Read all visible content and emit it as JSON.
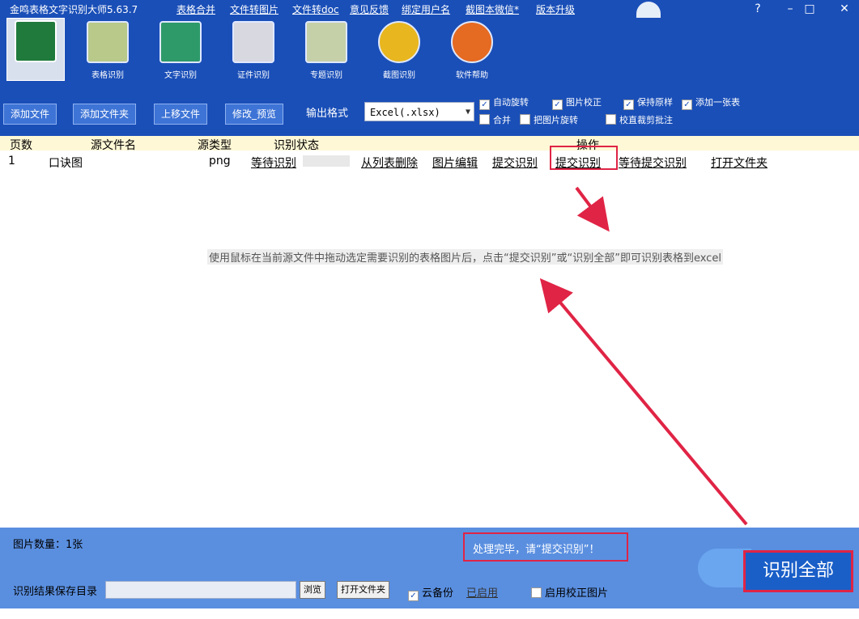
{
  "title_bar": {
    "app_title": "金鸣表格文字识别大师5.63.7",
    "menu": [
      "表格合并",
      "文件转图片",
      "文件转doc",
      "意见反馈",
      "绑定用户名",
      "截图本微信*",
      "版本升级"
    ],
    "win_min": "–",
    "win_max": "□",
    "win_close": "✕"
  },
  "toolbar": {
    "tools": [
      "",
      "表格识别",
      "文字识别",
      "证件识别",
      "专题识别",
      "截图识别",
      "软件帮助"
    ]
  },
  "options": {
    "buttons": [
      "添加文件",
      "添加文件夹",
      "上移文件",
      "修改_预览"
    ],
    "format_label": "输出格式",
    "format_value": "Excel(.xlsx)",
    "checkboxes_row1": [
      "自动旋转",
      "图片校正",
      "保持原样",
      "添加一张表"
    ],
    "checkboxes_row2": [
      "合并",
      "把图片旋转",
      "校直裁剪批注"
    ]
  },
  "table": {
    "headers": [
      "页数",
      "源文件名",
      "源类型",
      "识别状态",
      "操作"
    ],
    "row": {
      "page": "1",
      "filename": "口诀图",
      "type": "png",
      "status": "等待识别",
      "actions": [
        "从列表删除",
        "图片编辑",
        "提交识别",
        "提交识别",
        "等待提交识别",
        "打开文件夹"
      ]
    }
  },
  "hint": "使用鼠标在当前源文件中拖动选定需要识别的表格图片后，点击“提交识别”或“识别全部”即可识别表格到excel",
  "bottom": {
    "count_label": "图片数量",
    "count_value": "1张",
    "status_text": "处理完毕，请“提交识别”！",
    "dir_label": "识别结果保存目录",
    "browse_label": "浏览",
    "open_folder_label": "打开文件夹",
    "cloud_label": "云备份",
    "cloud_status": "已启用",
    "force_label": "启用校正图片",
    "recognize_all": "识别全部"
  },
  "colors": {
    "title_blue": "#1a4fb8",
    "bottom_blue": "#5a8fe0",
    "highlight_red": "#e02445"
  }
}
